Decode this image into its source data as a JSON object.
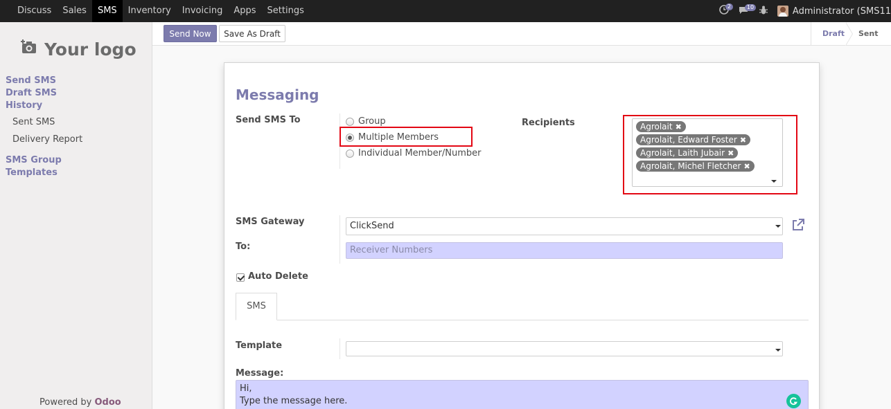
{
  "topbar": {
    "menu": [
      "Discuss",
      "Sales",
      "SMS",
      "Inventory",
      "Invoicing",
      "Apps",
      "Settings"
    ],
    "active_menu": "SMS",
    "activity_count": "2",
    "message_count": "10",
    "user": "Administrator (SMS11"
  },
  "sidebar": {
    "logo_text": "Your logo",
    "sections": [
      {
        "label": "Send SMS"
      },
      {
        "label": "Draft SMS"
      },
      {
        "label": "History"
      }
    ],
    "history_items": [
      "Sent SMS",
      "Delivery Report"
    ],
    "group_label": "SMS Group",
    "templates_label": "Templates",
    "powered_by": "Powered by",
    "powered_brand": "Odoo"
  },
  "control_panel": {
    "send_now": "Send Now",
    "save_draft": "Save As Draft",
    "status_draft": "Draft",
    "status_sent": "Sent"
  },
  "form": {
    "title": "Messaging",
    "send_sms_to_label": "Send SMS To",
    "options": [
      "Group",
      "Multiple Members",
      "Individual Member/Number"
    ],
    "selected_option": "Multiple Members",
    "recipients_label": "Recipients",
    "recipients": [
      "Agrolait",
      "Agrolait, Edward Foster",
      "Agrolait, Laith Jubair",
      "Agrolait, Michel Fletcher"
    ],
    "gateway_label": "SMS Gateway",
    "gateway_value": "ClickSend",
    "to_label": "To:",
    "to_placeholder": "Receiver Numbers",
    "auto_delete_label": "Auto Delete",
    "auto_delete_checked": true,
    "tab_label": "SMS",
    "template_label": "Template",
    "template_value": "",
    "message_label": "Message:",
    "message_line1": "Hi,",
    "message_line2": "Type the message here."
  },
  "colors": {
    "brand": "#7c7bad",
    "highlight": "#e30613",
    "required_field": "#d2d2ff"
  }
}
